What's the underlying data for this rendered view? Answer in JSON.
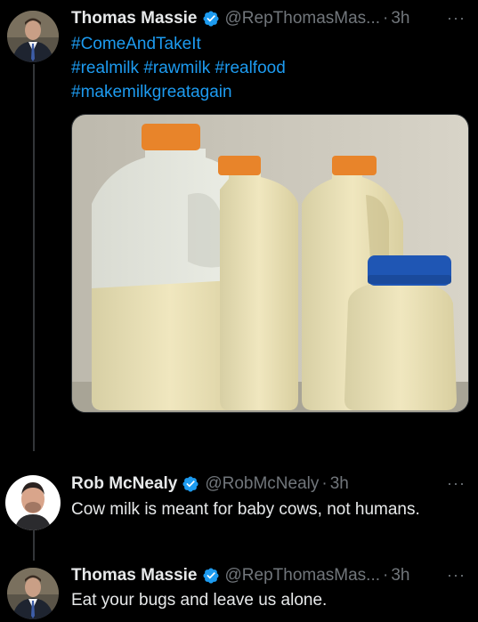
{
  "tweets": [
    {
      "name": "Thomas Massie",
      "handle": "@RepThomasMas...",
      "time": "3h",
      "hashtags": [
        "#ComeAndTakeIt",
        "#realmilk",
        "#rawmilk",
        "#realfood",
        "#makemilkgreatagain"
      ],
      "image_alt": "Four jugs and bottles of milk with orange and blue caps"
    },
    {
      "name": "Rob McNealy",
      "handle": "@RobMcNealy",
      "time": "3h",
      "text": "Cow milk is meant for baby cows, not humans."
    },
    {
      "name": "Thomas Massie",
      "handle": "@RepThomasMas...",
      "time": "3h",
      "text": "Eat your bugs and leave us alone."
    }
  ],
  "ui": {
    "dot": "·",
    "more": "···"
  },
  "colors": {
    "link": "#1d9bf0",
    "verified": "#1d9bf0",
    "muted": "#71767b"
  },
  "icons": {
    "verified": "verified-badge-icon",
    "more": "more-options-icon"
  }
}
